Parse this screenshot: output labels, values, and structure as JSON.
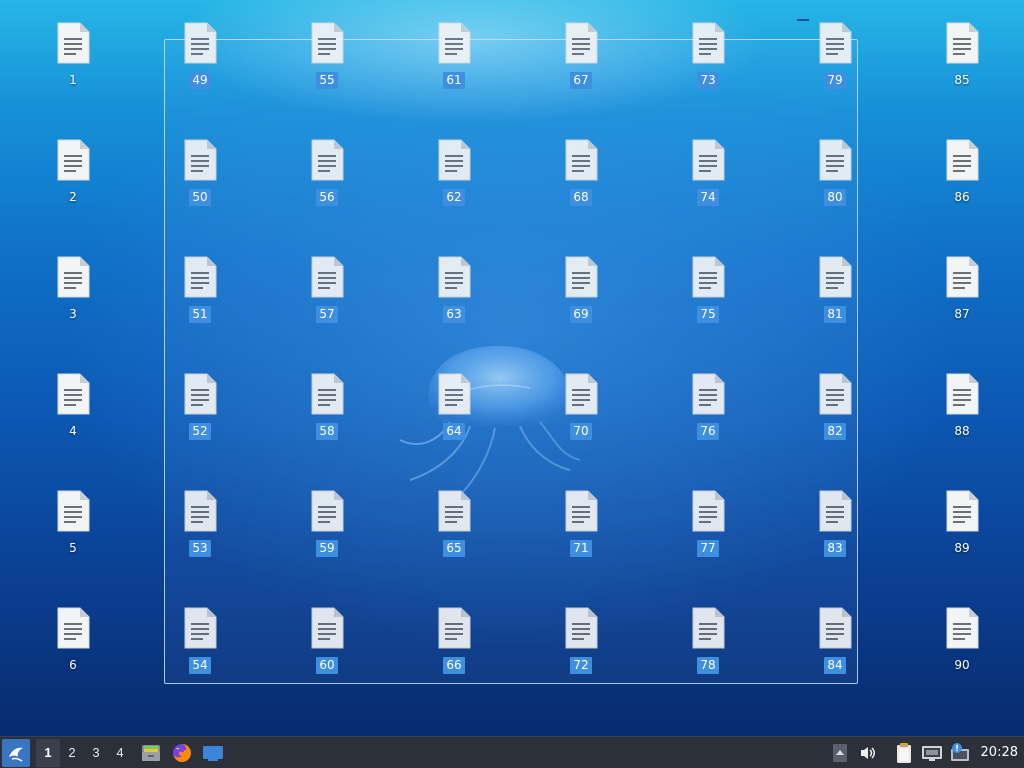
{
  "desktop": {
    "icons_left_column": [
      "1",
      "2",
      "3",
      "4",
      "5",
      "6"
    ],
    "icons_right_column": [
      "85",
      "86",
      "87",
      "88",
      "89",
      "90"
    ],
    "selected_icon_columns": [
      [
        "49",
        "50",
        "51",
        "52",
        "53",
        "54"
      ],
      [
        "55",
        "56",
        "57",
        "58",
        "59",
        "60"
      ],
      [
        "61",
        "62",
        "63",
        "64",
        "65",
        "66"
      ],
      [
        "67",
        "68",
        "69",
        "70",
        "71",
        "72"
      ],
      [
        "73",
        "74",
        "75",
        "76",
        "77",
        "78"
      ],
      [
        "79",
        "80",
        "81",
        "82",
        "83",
        "84"
      ]
    ],
    "icon_type": "text-document-icon"
  },
  "taskbar": {
    "workspaces": [
      "1",
      "2",
      "3",
      "4"
    ],
    "active_workspace": "1",
    "launchers": [
      "file-manager-icon",
      "firefox-icon",
      "show-desktop-icon"
    ],
    "tray": [
      "notification-arrow-icon",
      "volume-icon",
      "clipboard-icon",
      "network-icon",
      "updates-icon"
    ],
    "clock": "20:28"
  },
  "colors": {
    "selection_label": "#3e8fe0",
    "taskbar_bg": "#2b3039",
    "start_button": "#3a74c4"
  }
}
